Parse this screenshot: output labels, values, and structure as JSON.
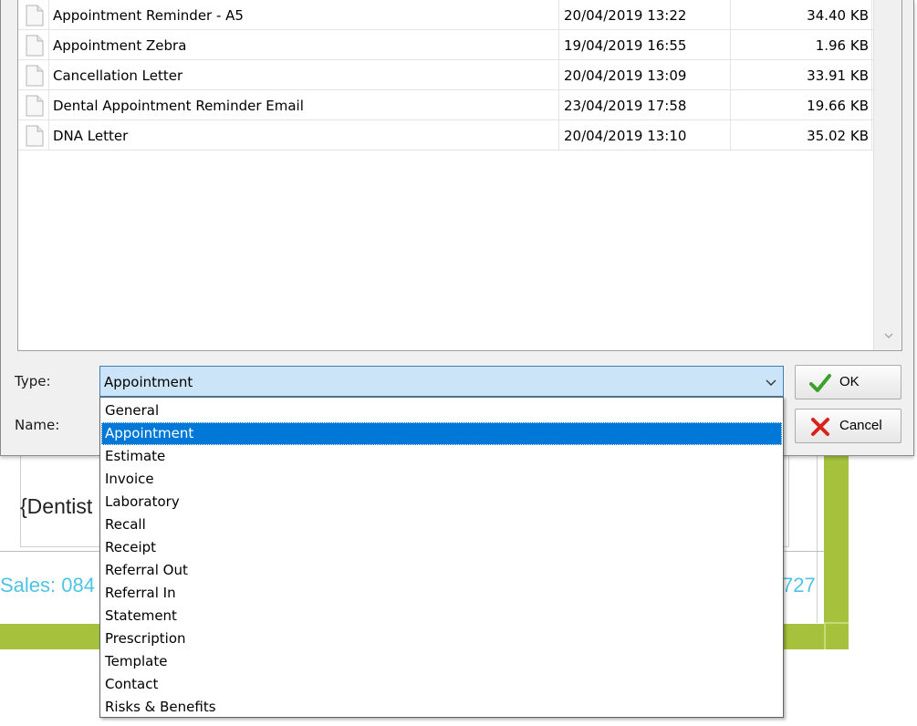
{
  "files": [
    {
      "name": "Appointment Reminder - A5",
      "date": "20/04/2019 13:22",
      "size": "34.40 KB"
    },
    {
      "name": "Appointment Zebra",
      "date": "19/04/2019 16:55",
      "size": "1.96 KB"
    },
    {
      "name": "Cancellation Letter",
      "date": "20/04/2019 13:09",
      "size": "33.91 KB"
    },
    {
      "name": "Dental Appointment Reminder Email",
      "date": "23/04/2019 17:58",
      "size": "19.66 KB"
    },
    {
      "name": "DNA Letter",
      "date": "20/04/2019 13:10",
      "size": "35.02 KB"
    }
  ],
  "form": {
    "type_label": "Type:",
    "name_label": "Name:",
    "type_value": "Appointment"
  },
  "type_options": [
    "General",
    "Appointment",
    "Estimate",
    "Invoice",
    "Laboratory",
    "Recall",
    "Receipt",
    "Referral Out",
    "Referral In",
    "Statement",
    "Prescription",
    "Template",
    "Contact",
    "Risks & Benefits"
  ],
  "selected_option_index": 1,
  "buttons": {
    "ok_label": "OK",
    "cancel_label": "Cancel"
  },
  "background": {
    "placeholder_text": "{Dentist",
    "sales_left": "Sales: 084",
    "sales_right": "727"
  },
  "colors": {
    "accent_green": "#a6c23c",
    "link_blue": "#4fc3e6",
    "selection_blue": "#0078d7",
    "ok_check": "#3aa12a",
    "cancel_x": "#d9221c"
  },
  "icons": {
    "file": "document-icon",
    "ok": "checkmark-icon",
    "cancel": "x-icon",
    "combo_arrow": "chevron-down-icon"
  }
}
